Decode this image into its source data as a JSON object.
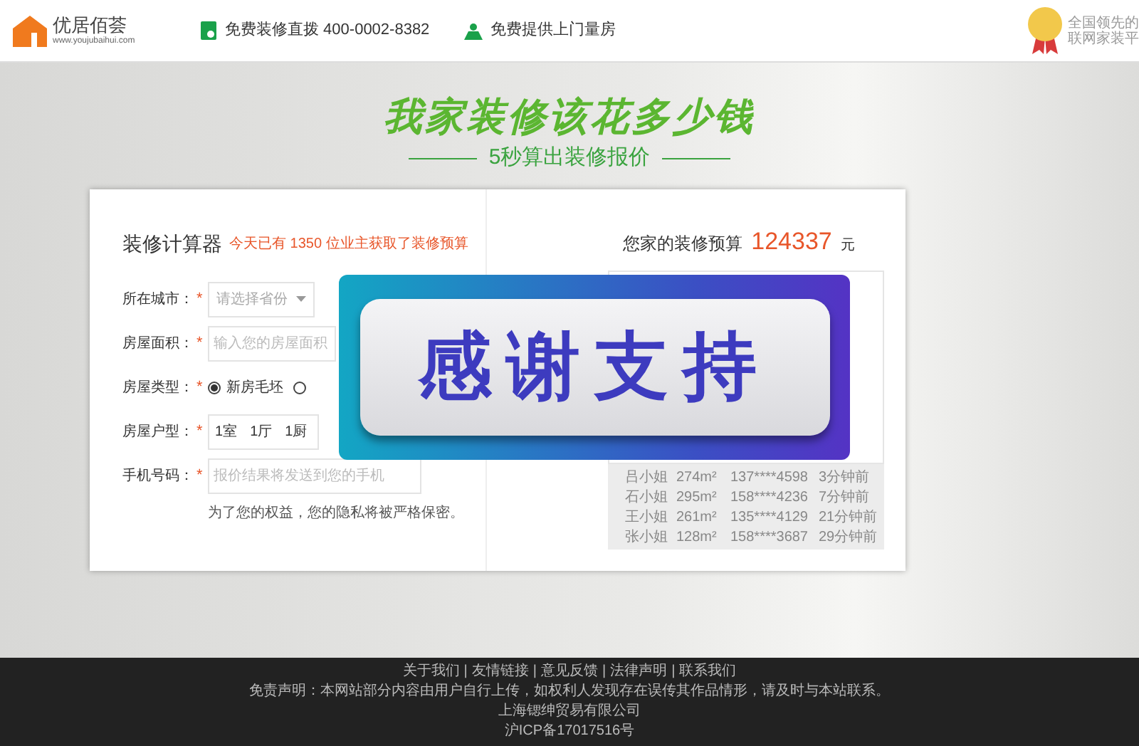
{
  "header": {
    "logo": {
      "name": "优居佰荟",
      "url": "www.youjubaihui.com"
    },
    "contacts": [
      {
        "kind": "phone",
        "text": "免费装修直拨 400-0002-8382"
      },
      {
        "kind": "measure",
        "text": "免费提供上门量房"
      }
    ],
    "badge_lines": [
      "全国领先的",
      "联网家装平"
    ]
  },
  "hero": {
    "title": "我家装修该花多少钱",
    "subtitle": "5秒算出装修报价"
  },
  "calculator": {
    "title": "装修计算器",
    "notice": "今天已有 1350 位业主获取了装修预算",
    "required_mark": "*",
    "fields": [
      {
        "kind": "select",
        "label": "所在城市：",
        "required": true,
        "placeholder": "请选择省份"
      },
      {
        "kind": "input",
        "label": "房屋面积：",
        "required": true,
        "placeholder": "输入您的房屋面积"
      },
      {
        "kind": "radio",
        "label": "房屋类型：",
        "required": true,
        "options": [
          {
            "label": "新房毛坯",
            "selected": true
          },
          {
            "selected": false
          }
        ]
      },
      {
        "kind": "rooms",
        "label": "房屋户型：",
        "required": true,
        "values": [
          "1室",
          "1厅",
          "1厨"
        ]
      },
      {
        "kind": "input",
        "label": "手机号码：",
        "required": true,
        "placeholder": "报价结果将发送到您的手机"
      }
    ],
    "privacy": "为了您的权益，您的隐私将被严格保密。"
  },
  "budget": {
    "label": "您家的装修预算",
    "amount": "124337",
    "unit": "元",
    "records": [
      [
        "吕小姐",
        "274m²",
        "137****4598",
        "3分钟前"
      ],
      [
        "石小姐",
        "295m²",
        "158****4236",
        "7分钟前"
      ],
      [
        "王小姐",
        "261m²",
        "135****4129",
        "21分钟前"
      ],
      [
        "张小姐",
        "128m²",
        "158****3687",
        "29分钟前"
      ]
    ]
  },
  "overlay": {
    "text": "感谢支持"
  },
  "footer": {
    "separator": "|",
    "links": [
      "关于我们",
      "友情链接",
      "意见反馈",
      "法律声明",
      "联系我们"
    ],
    "lines": [
      "免责声明：本网站部分内容由用户自行上传，如权利人发现存在误传其作品情形，请及时与本站联系。",
      "上海锶绅贸易有限公司",
      "沪ICP备17017516号"
    ]
  }
}
